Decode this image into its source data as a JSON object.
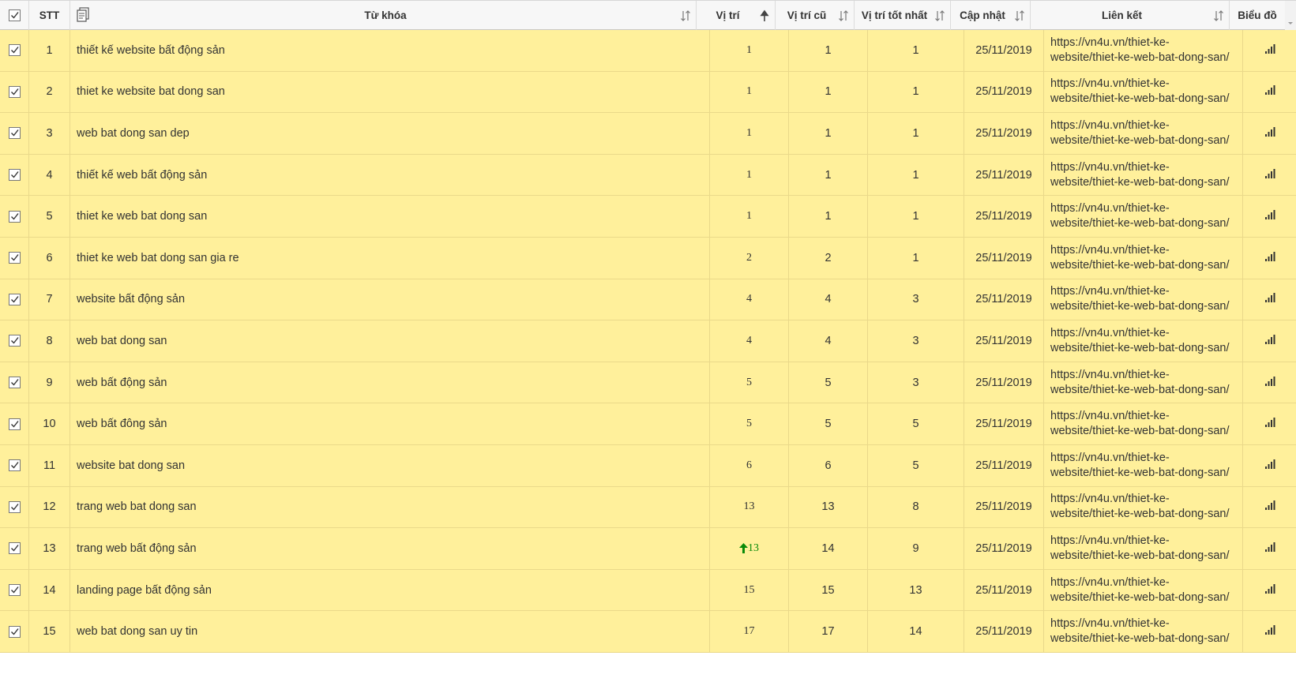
{
  "header": {
    "stt": "STT",
    "keyword": "Từ khóa",
    "position": "Vị trí",
    "old_position": "Vị trí cũ",
    "best_position": "Vị trí tốt nhất",
    "updated": "Cập nhật",
    "link": "Liên kết",
    "chart": "Biểu đồ"
  },
  "rows": [
    {
      "stt": "1",
      "keyword": "thiết kế website bất động sản",
      "position": "1",
      "old": "1",
      "best": "1",
      "date": "25/11/2019",
      "link": "https://vn4u.vn/thiet-ke-\nwebsite/thiet-ke-web-bat-dong-san/",
      "trend": ""
    },
    {
      "stt": "2",
      "keyword": "thiet ke website bat dong san",
      "position": "1",
      "old": "1",
      "best": "1",
      "date": "25/11/2019",
      "link": "https://vn4u.vn/thiet-ke-\nwebsite/thiet-ke-web-bat-dong-san/",
      "trend": ""
    },
    {
      "stt": "3",
      "keyword": "web bat dong san dep",
      "position": "1",
      "old": "1",
      "best": "1",
      "date": "25/11/2019",
      "link": "https://vn4u.vn/thiet-ke-\nwebsite/thiet-ke-web-bat-dong-san/",
      "trend": ""
    },
    {
      "stt": "4",
      "keyword": "thiết kế web bất động sản",
      "position": "1",
      "old": "1",
      "best": "1",
      "date": "25/11/2019",
      "link": "https://vn4u.vn/thiet-ke-\nwebsite/thiet-ke-web-bat-dong-san/",
      "trend": ""
    },
    {
      "stt": "5",
      "keyword": "thiet ke web bat dong san",
      "position": "1",
      "old": "1",
      "best": "1",
      "date": "25/11/2019",
      "link": "https://vn4u.vn/thiet-ke-\nwebsite/thiet-ke-web-bat-dong-san/",
      "trend": ""
    },
    {
      "stt": "6",
      "keyword": "thiet ke web bat dong san gia re",
      "position": "2",
      "old": "2",
      "best": "1",
      "date": "25/11/2019",
      "link": "https://vn4u.vn/thiet-ke-\nwebsite/thiet-ke-web-bat-dong-san/",
      "trend": ""
    },
    {
      "stt": "7",
      "keyword": "website bất động sản",
      "position": "4",
      "old": "4",
      "best": "3",
      "date": "25/11/2019",
      "link": "https://vn4u.vn/thiet-ke-\nwebsite/thiet-ke-web-bat-dong-san/",
      "trend": ""
    },
    {
      "stt": "8",
      "keyword": "web bat dong san",
      "position": "4",
      "old": "4",
      "best": "3",
      "date": "25/11/2019",
      "link": "https://vn4u.vn/thiet-ke-\nwebsite/thiet-ke-web-bat-dong-san/",
      "trend": ""
    },
    {
      "stt": "9",
      "keyword": "web bất động sản",
      "position": "5",
      "old": "5",
      "best": "3",
      "date": "25/11/2019",
      "link": "https://vn4u.vn/thiet-ke-\nwebsite/thiet-ke-web-bat-dong-san/",
      "trend": ""
    },
    {
      "stt": "10",
      "keyword": "web bất đông sản",
      "position": "5",
      "old": "5",
      "best": "5",
      "date": "25/11/2019",
      "link": "https://vn4u.vn/thiet-ke-\nwebsite/thiet-ke-web-bat-dong-san/",
      "trend": ""
    },
    {
      "stt": "11",
      "keyword": "website bat dong san",
      "position": "6",
      "old": "6",
      "best": "5",
      "date": "25/11/2019",
      "link": "https://vn4u.vn/thiet-ke-\nwebsite/thiet-ke-web-bat-dong-san/",
      "trend": ""
    },
    {
      "stt": "12",
      "keyword": "trang web bat dong san",
      "position": "13",
      "old": "13",
      "best": "8",
      "date": "25/11/2019",
      "link": "https://vn4u.vn/thiet-ke-\nwebsite/thiet-ke-web-bat-dong-san/",
      "trend": ""
    },
    {
      "stt": "13",
      "keyword": "trang web bất động sản",
      "position": "13",
      "old": "14",
      "best": "9",
      "date": "25/11/2019",
      "link": "https://vn4u.vn/thiet-ke-\nwebsite/thiet-ke-web-bat-dong-san/",
      "trend": "up"
    },
    {
      "stt": "14",
      "keyword": "landing page bất động sản",
      "position": "15",
      "old": "15",
      "best": "13",
      "date": "25/11/2019",
      "link": "https://vn4u.vn/thiet-ke-\nwebsite/thiet-ke-web-bat-dong-san/",
      "trend": ""
    },
    {
      "stt": "15",
      "keyword": "web bat dong san uy tin",
      "position": "17",
      "old": "17",
      "best": "14",
      "date": "25/11/2019",
      "link": "https://vn4u.vn/thiet-ke-\nwebsite/thiet-ke-web-bat-dong-san/",
      "trend": ""
    }
  ],
  "colors": {
    "row_bg": "#fff09b",
    "trend_up": "#0a8a0a"
  }
}
